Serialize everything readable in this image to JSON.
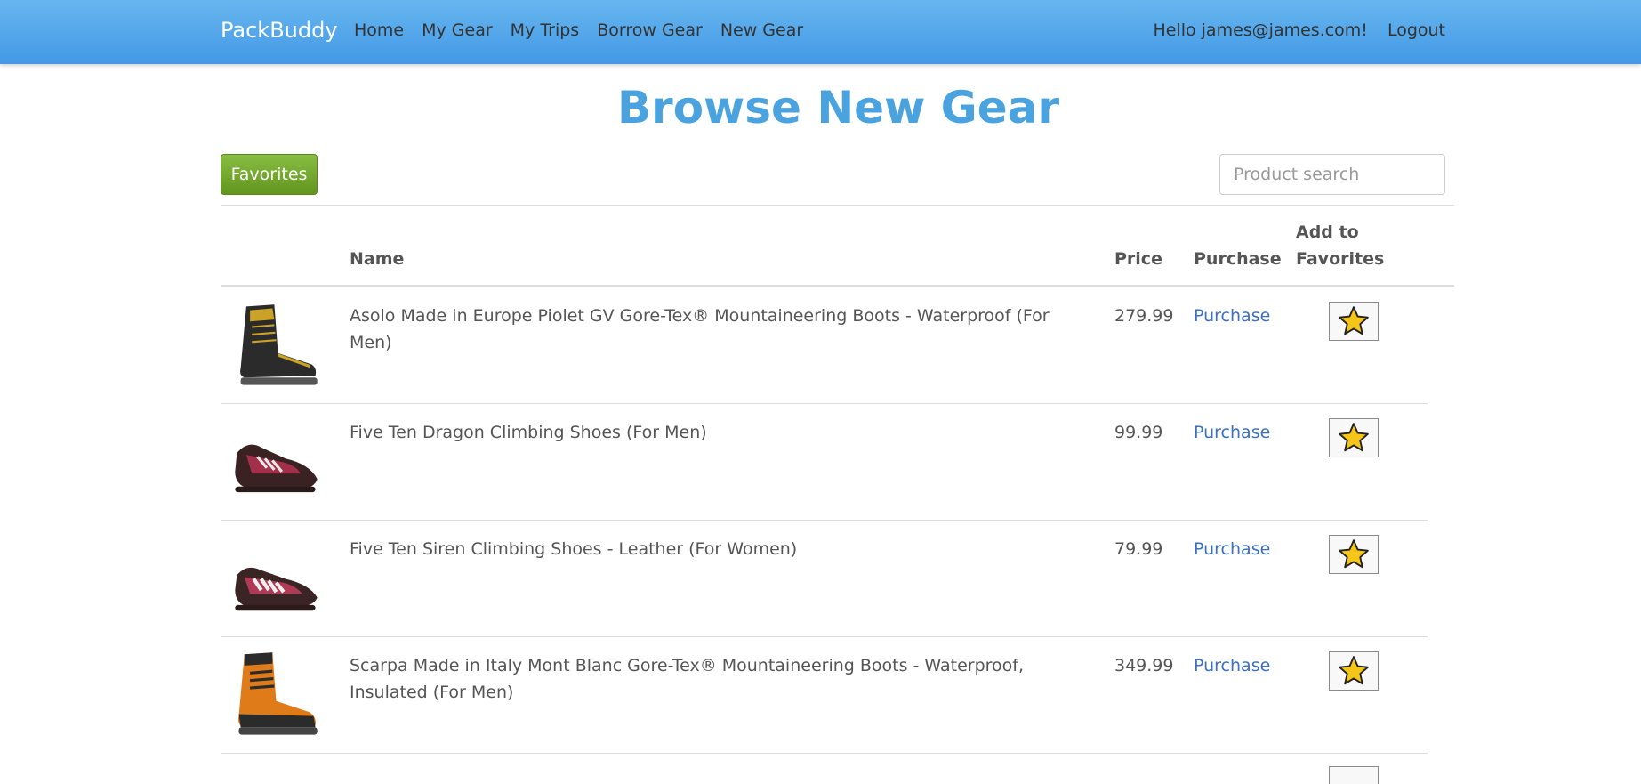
{
  "navbar": {
    "brand": "PackBuddy",
    "links": [
      "Home",
      "My Gear",
      "My Trips",
      "Borrow Gear",
      "New Gear"
    ],
    "greeting": "Hello james@james.com!",
    "logout": "Logout"
  },
  "page": {
    "title": "Browse New Gear",
    "favorites_button": "Favorites",
    "search_placeholder": "Product search"
  },
  "table": {
    "headers": {
      "name": "Name",
      "price": "Price",
      "purchase": "Purchase",
      "favorites_line1": "Add to",
      "favorites_line2": "Favorites"
    },
    "rows": [
      {
        "name": "Asolo Made in Europe Piolet GV Gore-Tex® Mountaineering Boots - Waterproof (For Men)",
        "price": "279.99",
        "purchase": "Purchase",
        "image": "mountaineering-boot-black-yellow"
      },
      {
        "name": "Five Ten Dragon Climbing Shoes (For Men)",
        "price": "99.99",
        "purchase": "Purchase",
        "image": "climbing-shoe-red"
      },
      {
        "name": "Five Ten Siren Climbing Shoes - Leather (For Women)",
        "price": "79.99",
        "purchase": "Purchase",
        "image": "climbing-shoe-red-white"
      },
      {
        "name": "Scarpa Made in Italy Mont Blanc Gore-Tex® Mountaineering Boots - Waterproof, Insulated (For Men)",
        "price": "349.99",
        "purchase": "Purchase",
        "image": "mountaineering-boot-orange"
      }
    ]
  },
  "colors": {
    "navbar": "#4299e5",
    "title": "#4aa3df",
    "favorites_button": "#6fa52b",
    "link": "#3b6fc0",
    "star": "#f5c518"
  },
  "icons": {
    "favorite": "star-icon"
  }
}
